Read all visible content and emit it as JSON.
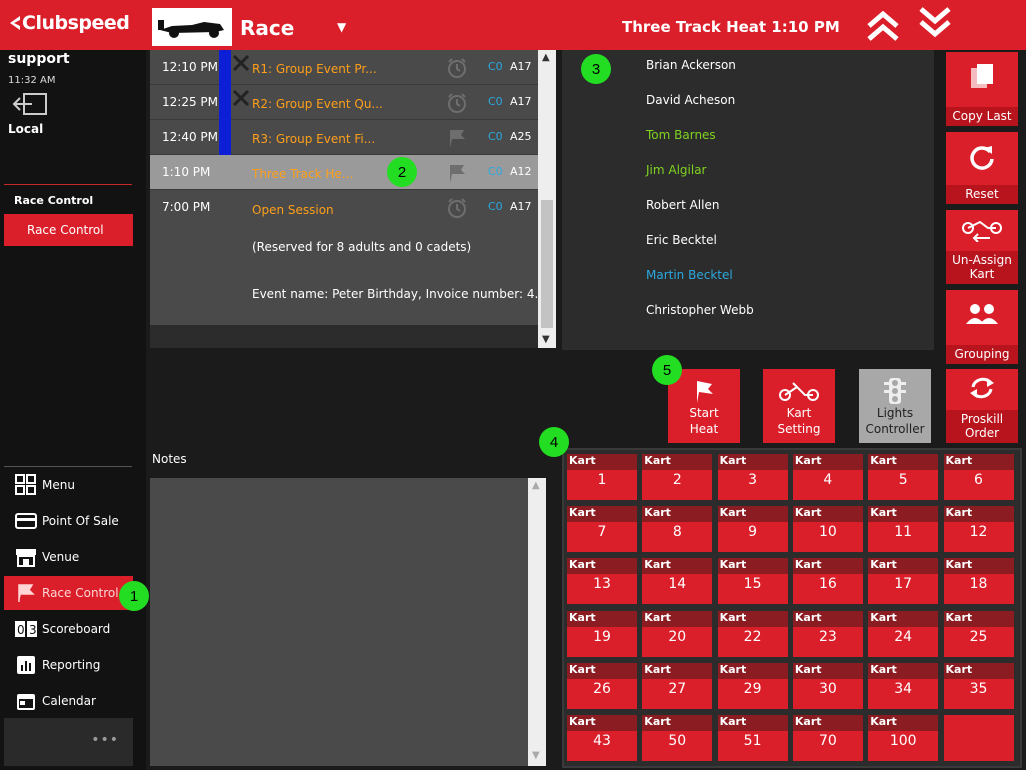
{
  "header": {
    "brand": "Clubspeed",
    "module": "Race",
    "heat_title": "Three Track Heat 1:10 PM"
  },
  "user": {
    "name": "support",
    "time": "11:32 AM",
    "location": "Local"
  },
  "sidebar": {
    "section_heading": "Race Control",
    "section_button": "Race Control",
    "nav": [
      {
        "label": "Menu",
        "icon": "grid-icon"
      },
      {
        "label": "Point Of Sale",
        "icon": "card-icon"
      },
      {
        "label": "Venue",
        "icon": "store-icon"
      },
      {
        "label": "Race Control",
        "icon": "flag-icon"
      },
      {
        "label": "Scoreboard",
        "icon": "scoreboard-icon"
      },
      {
        "label": "Reporting",
        "icon": "chart-icon"
      },
      {
        "label": "Calendar",
        "icon": "calendar-icon"
      }
    ],
    "more": "•••"
  },
  "heats": [
    {
      "time": "12:10 PM",
      "name": "R1: Group Event Pr...",
      "c": "C0",
      "a": "A17",
      "icon": "alarm-icon"
    },
    {
      "time": "12:25 PM",
      "name": "R2: Group Event Qu...",
      "c": "C0",
      "a": "A17",
      "icon": "alarm-icon"
    },
    {
      "time": "12:40 PM",
      "name": "R3: Group Event Fi...",
      "c": "C0",
      "a": "A25",
      "icon": "flag-icon"
    },
    {
      "time": "1:10 PM",
      "name": "Three Track He...",
      "c": "C0",
      "a": "A12",
      "icon": "flag-icon"
    },
    {
      "time": "7:00 PM",
      "name": "Open Session",
      "c": "C0",
      "a": "A17",
      "icon": "alarm-icon"
    }
  ],
  "open_session": {
    "reserved": "(Reserved for 8 adults and 0 cadets)",
    "event": "Event name: Peter Birthday, Invoice number: 4..."
  },
  "racers": [
    {
      "name": "Brian Ackerson",
      "color": "#ffffff"
    },
    {
      "name": "David Acheson",
      "color": "#ffffff"
    },
    {
      "name": "Tom Barnes",
      "color": "#7fd321"
    },
    {
      "name": "Jim Algilar",
      "color": "#7fd321"
    },
    {
      "name": "Robert Allen",
      "color": "#ffffff"
    },
    {
      "name": "Eric Becktel",
      "color": "#ffffff"
    },
    {
      "name": "Martin Becktel",
      "color": "#2aa9e0"
    },
    {
      "name": "Christopher Webb",
      "color": "#ffffff"
    }
  ],
  "actions": {
    "copy_last": "Copy Last",
    "reset": "Reset",
    "unassign_1": "Un-Assign",
    "unassign_2": "Kart",
    "grouping": "Grouping",
    "proskill_1": "Proskill",
    "proskill_2": "Order",
    "start_1": "Start",
    "start_2": "Heat",
    "kart_setting_1": "Kart",
    "kart_setting_2": "Setting",
    "lights_1": "Lights",
    "lights_2": "Controller"
  },
  "notes_label": "Notes",
  "kart_label": "Kart",
  "karts": [
    "1",
    "2",
    "3",
    "4",
    "5",
    "6",
    "7",
    "8",
    "9",
    "10",
    "11",
    "12",
    "13",
    "14",
    "15",
    "16",
    "17",
    "18",
    "19",
    "20",
    "22",
    "23",
    "24",
    "25",
    "26",
    "27",
    "29",
    "30",
    "34",
    "35",
    "43",
    "50",
    "51",
    "70",
    "100",
    ""
  ],
  "badges": [
    "1",
    "2",
    "3",
    "4",
    "5"
  ]
}
